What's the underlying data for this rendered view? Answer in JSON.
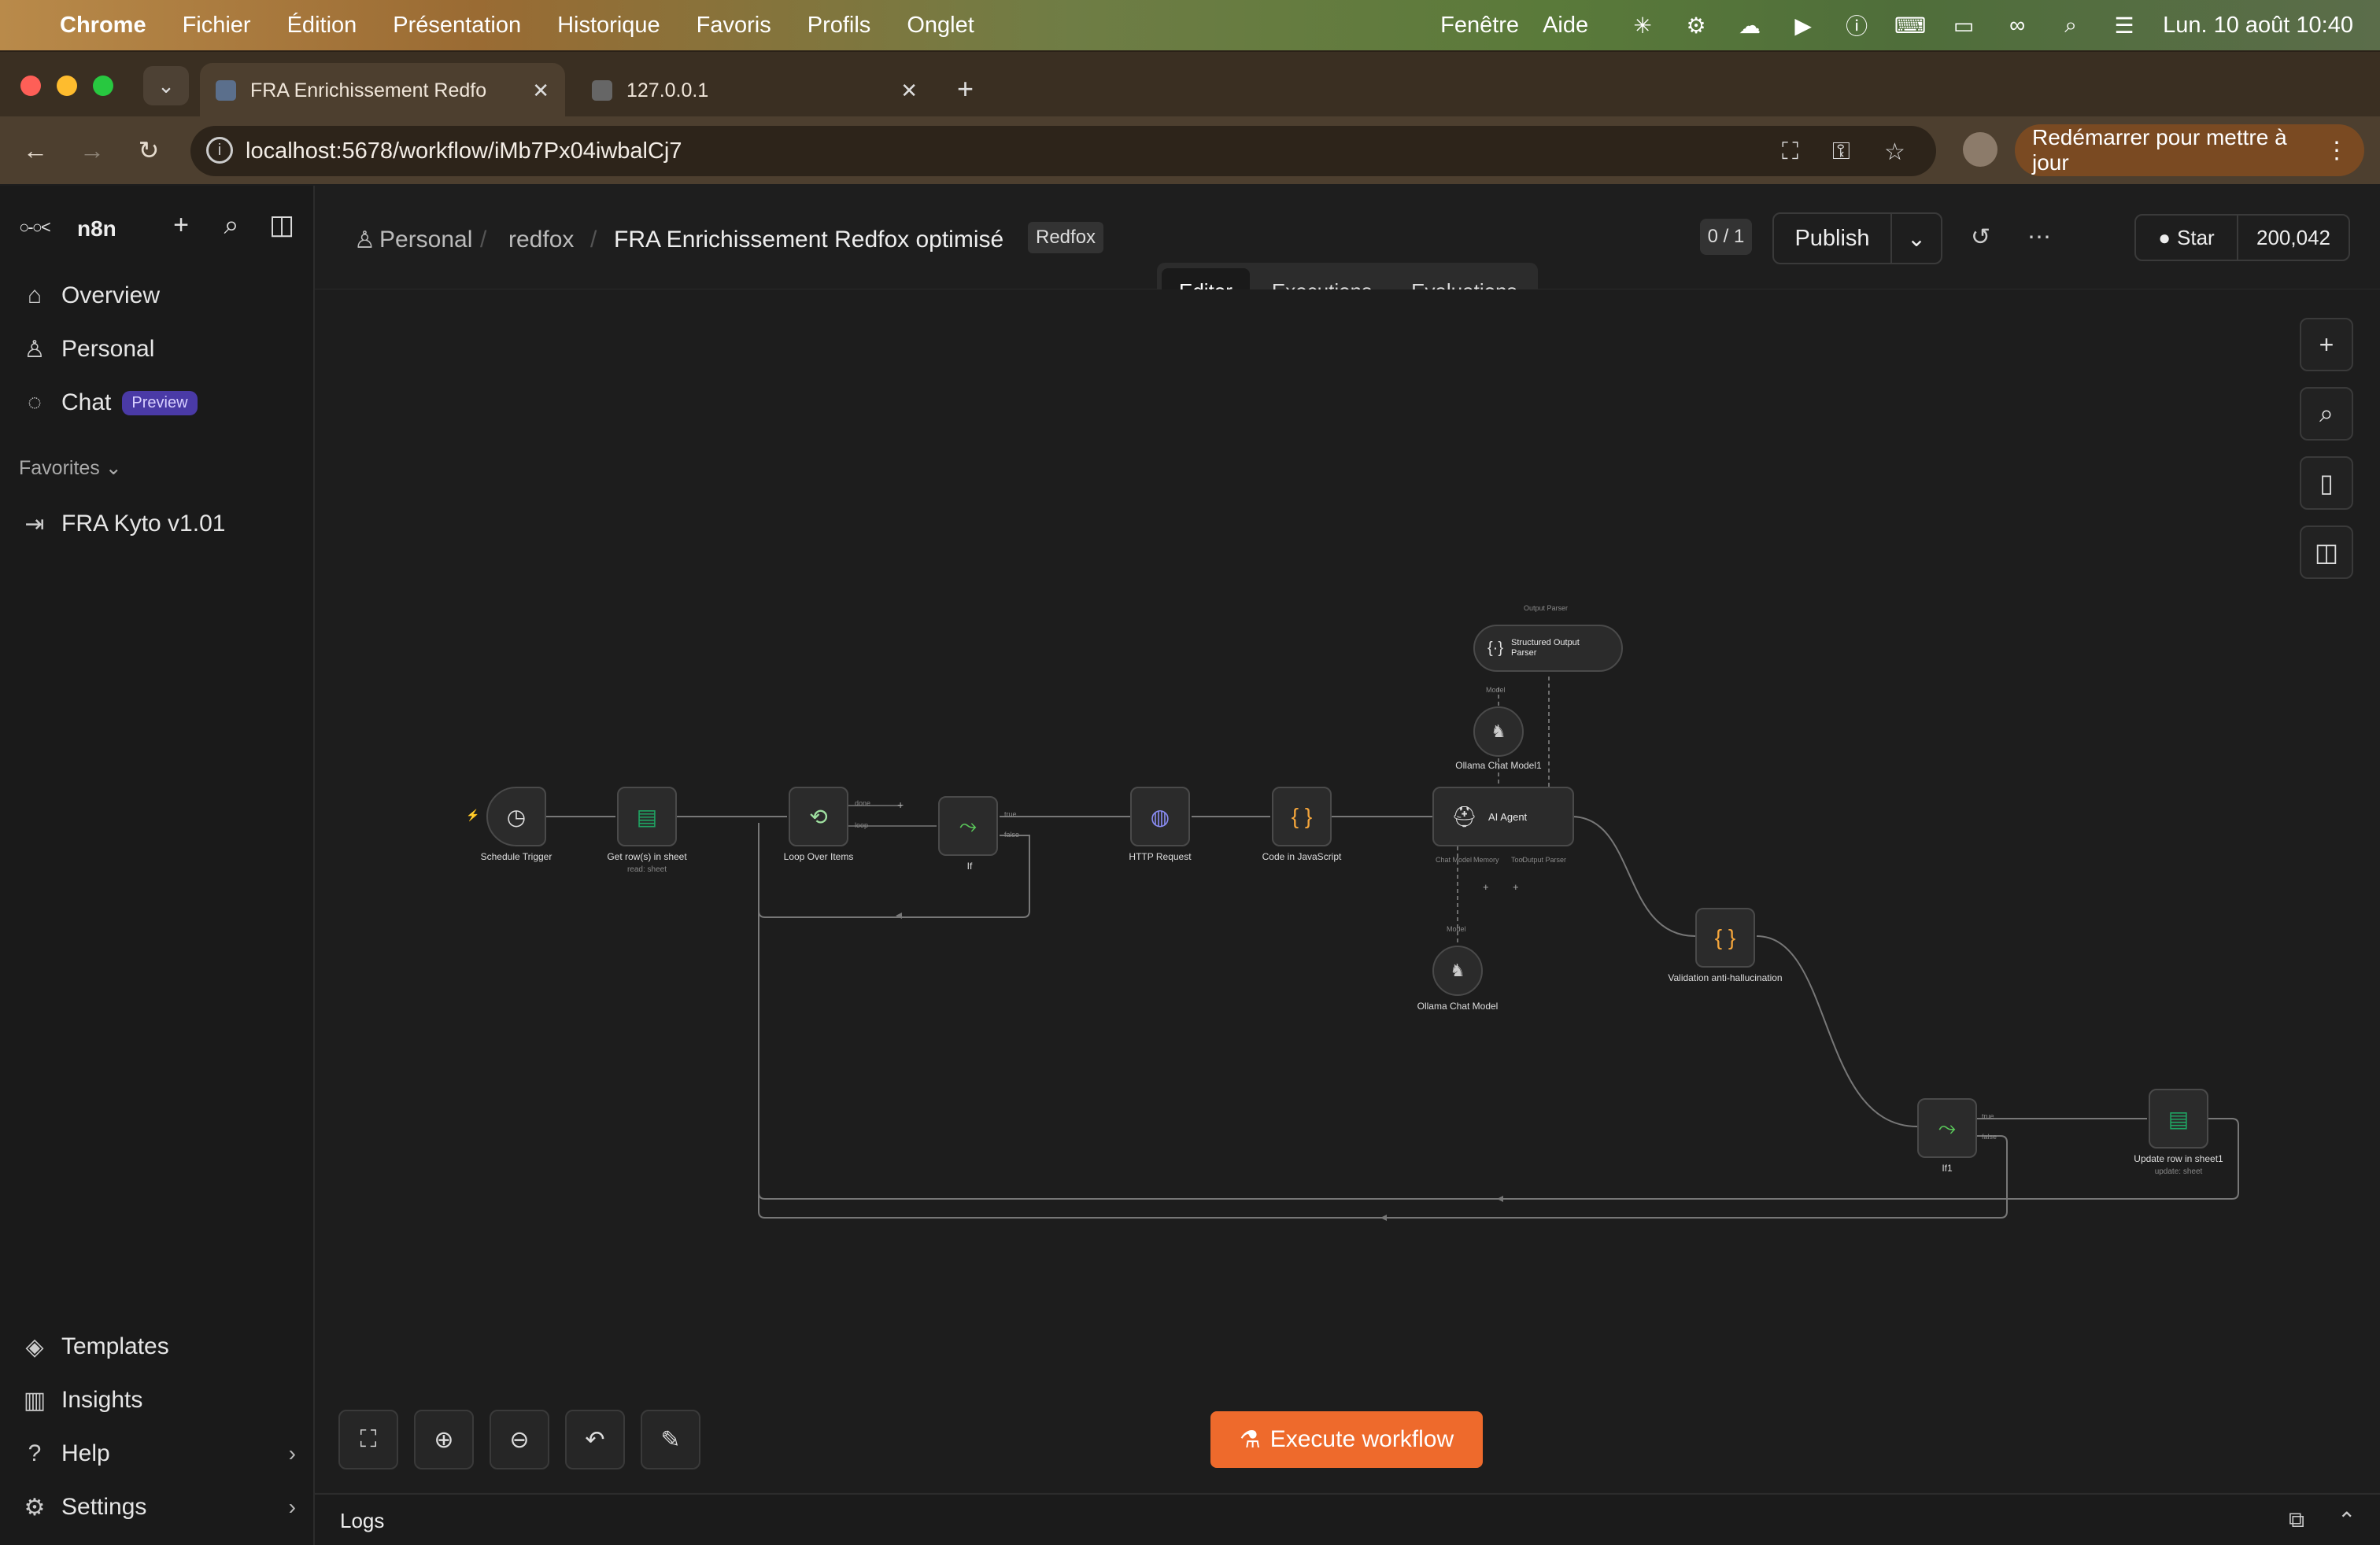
{
  "menubar": {
    "app": "Chrome",
    "items": [
      "Fichier",
      "Édition",
      "Présentation",
      "Historique",
      "Favoris",
      "Profils",
      "Onglet"
    ],
    "right_items": [
      "Fenêtre",
      "Aide"
    ],
    "clock": "Lun. 10 août  10:40"
  },
  "browser": {
    "tabs": [
      {
        "title": "FRA Enrichissement Redfo",
        "active": true
      },
      {
        "title": "127.0.0.1",
        "active": false
      }
    ],
    "url": "localhost:5678/workflow/iMb7Px04iwbalCj7",
    "update_label": "Redémarrer pour mettre à jour"
  },
  "sidebar": {
    "brand": "n8n",
    "items": [
      {
        "label": "Overview",
        "icon": "home-icon"
      },
      {
        "label": "Personal",
        "icon": "user-icon"
      },
      {
        "label": "Chat",
        "icon": "chat-icon",
        "badge": "Preview"
      }
    ],
    "favorites_label": "Favorites",
    "favorites": [
      {
        "label": "FRA Kyto v1.01",
        "icon": "sign-in-icon"
      }
    ],
    "bottom": [
      {
        "label": "Templates",
        "icon": "templates-icon"
      },
      {
        "label": "Insights",
        "icon": "insights-icon"
      },
      {
        "label": "Help",
        "icon": "help-icon"
      },
      {
        "label": "Settings",
        "icon": "settings-icon"
      }
    ]
  },
  "header": {
    "breadcrumb": [
      "Personal",
      "redfox",
      "FRA Enrichissement Redfox optimisé"
    ],
    "tag": "Redfox",
    "version_count": "0 / 1",
    "publish_label": "Publish",
    "github_star": "Star",
    "github_count": "200,042",
    "tabs": [
      "Editor",
      "Executions",
      "Evaluations"
    ],
    "active_tab": "Editor"
  },
  "canvas": {
    "execute_label": "Execute workflow",
    "logs_label": "Logs",
    "nodes": {
      "schedule": "Schedule Trigger",
      "get_rows": "Get row(s) in sheet",
      "get_rows_sub": "read: sheet",
      "loop": "Loop Over Items",
      "if": "If",
      "http": "HTTP Request",
      "code": "Code in JavaScript",
      "agent": "AI Agent",
      "parser": "Structured Output Parser",
      "ollama1": "Ollama Chat Model1",
      "ollama": "Ollama Chat Model",
      "validation": "Validation anti-hallucination",
      "if1": "If1",
      "update": "Update row in sheet1",
      "update_sub": "update: sheet"
    },
    "port_labels": {
      "done": "done",
      "loop": "loop",
      "true": "true",
      "false": "false",
      "output_parser_top": "Output Parser",
      "model_top": "Model",
      "chat_model": "Chat Model",
      "memory": "Memory",
      "tool": "Tool",
      "output_parser": "Output Parser",
      "model": "Model"
    }
  }
}
